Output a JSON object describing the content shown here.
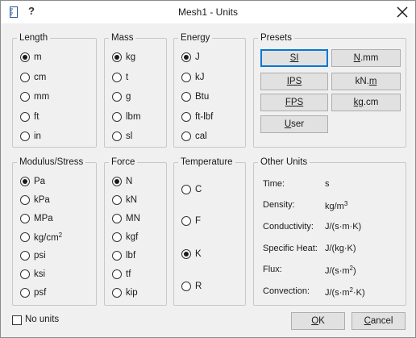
{
  "window": {
    "title": "Mesh1 - Units",
    "help_glyph": "?"
  },
  "groups": {
    "length": {
      "title": "Length",
      "options": [
        "m",
        "cm",
        "mm",
        "ft",
        "in"
      ],
      "selected": 0
    },
    "mass": {
      "title": "Mass",
      "options": [
        "kg",
        "t",
        "g",
        "lbm",
        "sl"
      ],
      "selected": 0
    },
    "energy": {
      "title": "Energy",
      "options": [
        "J",
        "kJ",
        "Btu",
        "ft-lbf",
        "cal"
      ],
      "selected": 0
    },
    "modulus": {
      "title": "Modulus/Stress",
      "options": [
        "Pa",
        "kPa",
        "MPa",
        "kg/cm",
        "psi",
        "ksi",
        "psf"
      ],
      "selected": 0,
      "kgcm_sup": "2"
    },
    "force": {
      "title": "Force",
      "options": [
        "N",
        "kN",
        "MN",
        "kgf",
        "lbf",
        "tf",
        "kip"
      ],
      "selected": 0
    },
    "temperature": {
      "title": "Temperature",
      "options": [
        "C",
        "F",
        "K",
        "R"
      ],
      "selected": 2
    }
  },
  "presets": {
    "title": "Presets",
    "buttons": [
      {
        "pre": "",
        "ul": "SI",
        "post": ""
      },
      {
        "pre": "",
        "ul": "N",
        "post": ".mm"
      },
      {
        "pre": "",
        "ul": "IPS",
        "post": ""
      },
      {
        "pre": "kN.",
        "ul": "m",
        "post": ""
      },
      {
        "pre": "",
        "ul": "FPS",
        "post": ""
      },
      {
        "pre": "",
        "ul": "kg",
        "post": ".cm"
      },
      {
        "pre": "",
        "ul": "U",
        "post": "ser"
      }
    ]
  },
  "other_units": {
    "title": "Other Units",
    "time": {
      "label": "Time:",
      "value": "s"
    },
    "density": {
      "label": "Density:",
      "value": "kg/m",
      "sup": "3"
    },
    "conductivity": {
      "label": "Conductivity:",
      "value": "J/(s·m·K)"
    },
    "specific_heat": {
      "label": "Specific Heat:",
      "value": "J/(kg·K)"
    },
    "flux": {
      "label": "Flux:",
      "value_a": "J/(s·m",
      "sup": "2",
      "value_b": ")"
    },
    "convection": {
      "label": "Convection:",
      "value_a": "J/(s·m",
      "sup": "2",
      "value_b": "·K)"
    }
  },
  "footer": {
    "no_units_label": "No units",
    "no_units_checked": false,
    "ok_ul": "O",
    "ok_rest": "K",
    "cancel_pre": "",
    "cancel_ul": "C",
    "cancel_rest": "ancel"
  }
}
